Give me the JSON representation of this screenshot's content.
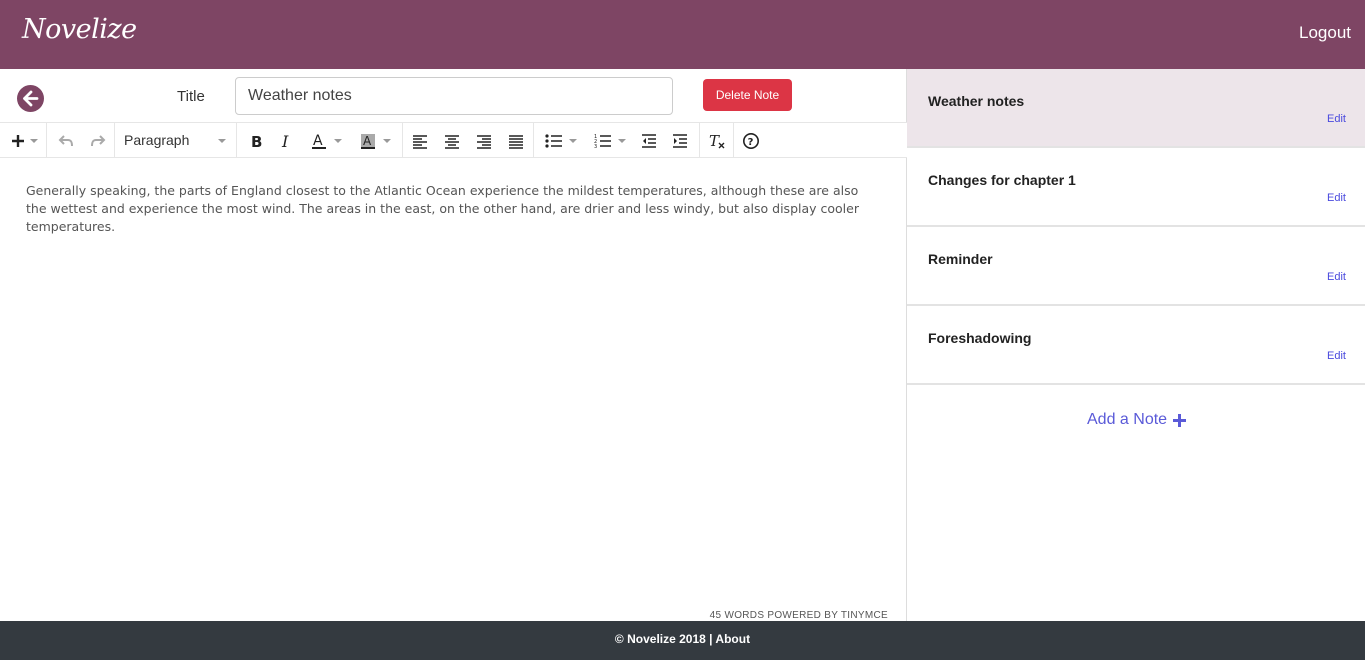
{
  "header": {
    "brand": "Novelize",
    "logout_label": "Logout"
  },
  "editor": {
    "title_label": "Title",
    "title_value": "Weather notes",
    "delete_label": "Delete Note",
    "format_select": "Paragraph",
    "content": "Generally speaking, the parts of England closest to the Atlantic Ocean experience the mildest temperatures, although these are also the wettest and experience the most wind. The areas in the east, on the other hand, are drier and less windy, but also display cooler temperatures.",
    "status": "45 WORDS POWERED BY TINYMCE",
    "toolbar_icons": [
      "plus-icon",
      "undo-icon",
      "redo-icon",
      "bold-icon",
      "italic-icon",
      "text-color-icon",
      "background-color-icon",
      "align-left-icon",
      "align-center-icon",
      "align-right-icon",
      "align-justify-icon",
      "bullet-list-icon",
      "numbered-list-icon",
      "outdent-icon",
      "indent-icon",
      "clear-formatting-icon",
      "help-icon"
    ]
  },
  "sidebar": {
    "notes": [
      {
        "title": "Weather notes",
        "edit": "Edit",
        "active": true
      },
      {
        "title": "Changes for chapter 1",
        "edit": "Edit",
        "active": false
      },
      {
        "title": "Reminder",
        "edit": "Edit",
        "active": false
      },
      {
        "title": "Foreshadowing",
        "edit": "Edit",
        "active": false
      }
    ],
    "add_note_label": "Add a Note"
  },
  "footer": {
    "copyright": "© Novelize 2018 |",
    "about": "About"
  },
  "colors": {
    "brand": "#7e4564",
    "danger": "#dc3545",
    "link": "#4a4ade",
    "footer": "#343a40",
    "active_note": "#ede5ea"
  }
}
